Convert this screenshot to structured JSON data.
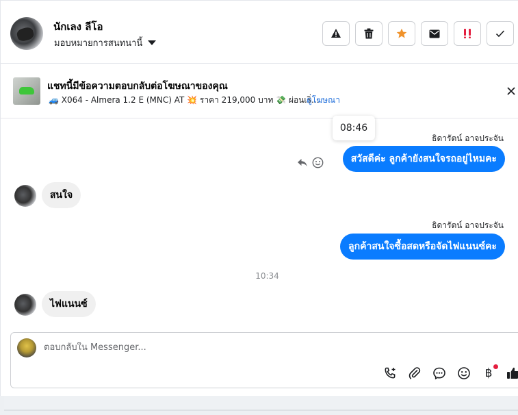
{
  "header": {
    "user_name": "นักเลง ลีโอ",
    "assign_label": "มอบหมายการสนทนานี้",
    "actions": [
      {
        "icon": "warning-icon"
      },
      {
        "icon": "trash-icon"
      },
      {
        "icon": "star-icon",
        "color": "#f0922b"
      },
      {
        "icon": "mail-icon"
      },
      {
        "icon": "spam-icon",
        "color": "#e41e3f"
      },
      {
        "icon": "check-icon"
      }
    ]
  },
  "ad_banner": {
    "title": "แชทนี้มีข้อความตอบกลับต่อโฆษณาของคุณ",
    "description": "🚙 X064 - Almera 1.2 E (MNC) AT 💥 ราคา 219,000 บาท 💸 ผ่อนเริ่...",
    "link_label": "ดูโฆษณา"
  },
  "messages": {
    "hover_time": "08:46",
    "sender_name_1": "ธิดารัตน์ อาจประจัน",
    "out_1": "สวัสดีค่ะ ลูกค้ายังสนใจรถอยู่ไหมคะ",
    "in_1": "สนใจ",
    "sender_name_2": "ธิดารัตน์ อาจประจัน",
    "out_2": "ลูกค้าสนใจซื้อสดหรือจัดไฟแนนซ์คะ",
    "divider_time": "10:34",
    "in_2": "ไฟแนนซ์"
  },
  "composer": {
    "placeholder": "ตอบกลับใน Messenger..."
  },
  "colors": {
    "accent": "#0a7cff",
    "link": "#216fdb"
  }
}
